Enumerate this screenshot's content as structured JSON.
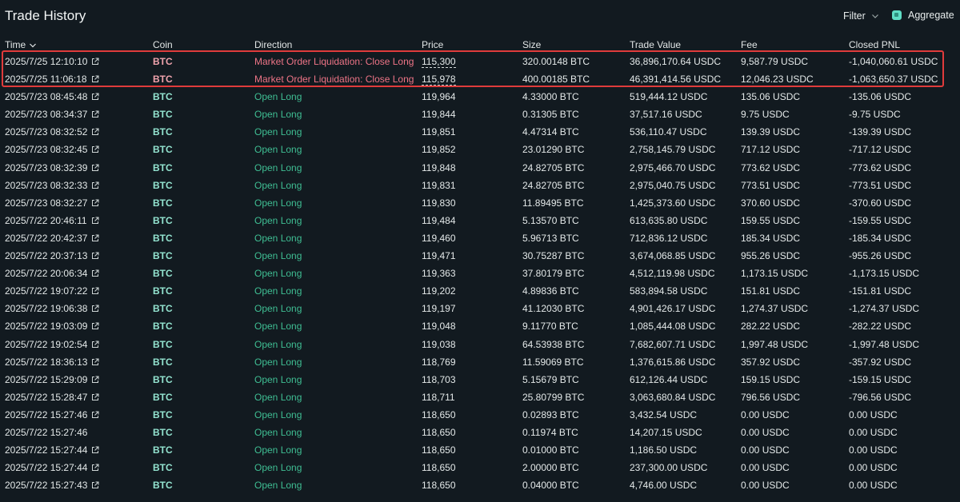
{
  "header": {
    "title": "Trade History",
    "filter_label": "Filter",
    "aggregate_label": "Aggregate",
    "aggregate_checked": true
  },
  "columns": [
    "Time",
    "Coin",
    "Direction",
    "Price",
    "Size",
    "Trade Value",
    "Fee",
    "Closed PNL"
  ],
  "colors": {
    "liquidation": "#ed7486",
    "open_long": "#3fbe93",
    "highlight_border": "#e03b3b",
    "checkbox": "#5fdcc4"
  },
  "rows": [
    {
      "time": "2025/7/25 12:10:10",
      "coin": "BTC",
      "direction": "Market Order Liquidation: Close Long",
      "price": "115,300",
      "size": "320.00148 BTC",
      "value": "36,896,170.64 USDC",
      "fee": "9,587.79 USDC",
      "pnl": "-1,040,060.61 USDC",
      "type": "liq"
    },
    {
      "time": "2025/7/25 11:06:18",
      "coin": "BTC",
      "direction": "Market Order Liquidation: Close Long",
      "price": "115,978",
      "size": "400.00185 BTC",
      "value": "46,391,414.56 USDC",
      "fee": "12,046.23 USDC",
      "pnl": "-1,063,650.37 USDC",
      "type": "liq"
    },
    {
      "time": "2025/7/23 08:45:48",
      "coin": "BTC",
      "direction": "Open Long",
      "price": "119,964",
      "size": "4.33000 BTC",
      "value": "519,444.12 USDC",
      "fee": "135.06 USDC",
      "pnl": "-135.06 USDC",
      "type": "long"
    },
    {
      "time": "2025/7/23 08:34:37",
      "coin": "BTC",
      "direction": "Open Long",
      "price": "119,844",
      "size": "0.31305 BTC",
      "value": "37,517.16 USDC",
      "fee": "9.75 USDC",
      "pnl": "-9.75 USDC",
      "type": "long"
    },
    {
      "time": "2025/7/23 08:32:52",
      "coin": "BTC",
      "direction": "Open Long",
      "price": "119,851",
      "size": "4.47314 BTC",
      "value": "536,110.47 USDC",
      "fee": "139.39 USDC",
      "pnl": "-139.39 USDC",
      "type": "long"
    },
    {
      "time": "2025/7/23 08:32:45",
      "coin": "BTC",
      "direction": "Open Long",
      "price": "119,852",
      "size": "23.01290 BTC",
      "value": "2,758,145.79 USDC",
      "fee": "717.12 USDC",
      "pnl": "-717.12 USDC",
      "type": "long"
    },
    {
      "time": "2025/7/23 08:32:39",
      "coin": "BTC",
      "direction": "Open Long",
      "price": "119,848",
      "size": "24.82705 BTC",
      "value": "2,975,466.70 USDC",
      "fee": "773.62 USDC",
      "pnl": "-773.62 USDC",
      "type": "long"
    },
    {
      "time": "2025/7/23 08:32:33",
      "coin": "BTC",
      "direction": "Open Long",
      "price": "119,831",
      "size": "24.82705 BTC",
      "value": "2,975,040.75 USDC",
      "fee": "773.51 USDC",
      "pnl": "-773.51 USDC",
      "type": "long"
    },
    {
      "time": "2025/7/23 08:32:27",
      "coin": "BTC",
      "direction": "Open Long",
      "price": "119,830",
      "size": "11.89495 BTC",
      "value": "1,425,373.60 USDC",
      "fee": "370.60 USDC",
      "pnl": "-370.60 USDC",
      "type": "long"
    },
    {
      "time": "2025/7/22 20:46:11",
      "coin": "BTC",
      "direction": "Open Long",
      "price": "119,484",
      "size": "5.13570 BTC",
      "value": "613,635.80 USDC",
      "fee": "159.55 USDC",
      "pnl": "-159.55 USDC",
      "type": "long"
    },
    {
      "time": "2025/7/22 20:42:37",
      "coin": "BTC",
      "direction": "Open Long",
      "price": "119,460",
      "size": "5.96713 BTC",
      "value": "712,836.12 USDC",
      "fee": "185.34 USDC",
      "pnl": "-185.34 USDC",
      "type": "long"
    },
    {
      "time": "2025/7/22 20:37:13",
      "coin": "BTC",
      "direction": "Open Long",
      "price": "119,471",
      "size": "30.75287 BTC",
      "value": "3,674,068.85 USDC",
      "fee": "955.26 USDC",
      "pnl": "-955.26 USDC",
      "type": "long"
    },
    {
      "time": "2025/7/22 20:06:34",
      "coin": "BTC",
      "direction": "Open Long",
      "price": "119,363",
      "size": "37.80179 BTC",
      "value": "4,512,119.98 USDC",
      "fee": "1,173.15 USDC",
      "pnl": "-1,173.15 USDC",
      "type": "long"
    },
    {
      "time": "2025/7/22 19:07:22",
      "coin": "BTC",
      "direction": "Open Long",
      "price": "119,202",
      "size": "4.89836 BTC",
      "value": "583,894.58 USDC",
      "fee": "151.81 USDC",
      "pnl": "-151.81 USDC",
      "type": "long"
    },
    {
      "time": "2025/7/22 19:06:38",
      "coin": "BTC",
      "direction": "Open Long",
      "price": "119,197",
      "size": "41.12030 BTC",
      "value": "4,901,426.17 USDC",
      "fee": "1,274.37 USDC",
      "pnl": "-1,274.37 USDC",
      "type": "long"
    },
    {
      "time": "2025/7/22 19:03:09",
      "coin": "BTC",
      "direction": "Open Long",
      "price": "119,048",
      "size": "9.11770 BTC",
      "value": "1,085,444.08 USDC",
      "fee": "282.22 USDC",
      "pnl": "-282.22 USDC",
      "type": "long"
    },
    {
      "time": "2025/7/22 19:02:54",
      "coin": "BTC",
      "direction": "Open Long",
      "price": "119,038",
      "size": "64.53938 BTC",
      "value": "7,682,607.71 USDC",
      "fee": "1,997.48 USDC",
      "pnl": "-1,997.48 USDC",
      "type": "long"
    },
    {
      "time": "2025/7/22 18:36:13",
      "coin": "BTC",
      "direction": "Open Long",
      "price": "118,769",
      "size": "11.59069 BTC",
      "value": "1,376,615.86 USDC",
      "fee": "357.92 USDC",
      "pnl": "-357.92 USDC",
      "type": "long"
    },
    {
      "time": "2025/7/22 15:29:09",
      "coin": "BTC",
      "direction": "Open Long",
      "price": "118,703",
      "size": "5.15679 BTC",
      "value": "612,126.44 USDC",
      "fee": "159.15 USDC",
      "pnl": "-159.15 USDC",
      "type": "long"
    },
    {
      "time": "2025/7/22 15:28:47",
      "coin": "BTC",
      "direction": "Open Long",
      "price": "118,711",
      "size": "25.80799 BTC",
      "value": "3,063,680.84 USDC",
      "fee": "796.56 USDC",
      "pnl": "-796.56 USDC",
      "type": "long"
    },
    {
      "time": "2025/7/22 15:27:46",
      "coin": "BTC",
      "direction": "Open Long",
      "price": "118,650",
      "size": "0.02893 BTC",
      "value": "3,432.54 USDC",
      "fee": "0.00 USDC",
      "pnl": "0.00 USDC",
      "type": "long",
      "link": true
    },
    {
      "time": "2025/7/22 15:27:46",
      "coin": "BTC",
      "direction": "Open Long",
      "price": "118,650",
      "size": "0.11974 BTC",
      "value": "14,207.15 USDC",
      "fee": "0.00 USDC",
      "pnl": "0.00 USDC",
      "type": "long",
      "link": false
    },
    {
      "time": "2025/7/22 15:27:44",
      "coin": "BTC",
      "direction": "Open Long",
      "price": "118,650",
      "size": "0.01000 BTC",
      "value": "1,186.50 USDC",
      "fee": "0.00 USDC",
      "pnl": "0.00 USDC",
      "type": "long"
    },
    {
      "time": "2025/7/22 15:27:44",
      "coin": "BTC",
      "direction": "Open Long",
      "price": "118,650",
      "size": "2.00000 BTC",
      "value": "237,300.00 USDC",
      "fee": "0.00 USDC",
      "pnl": "0.00 USDC",
      "type": "long"
    },
    {
      "time": "2025/7/22 15:27:43",
      "coin": "BTC",
      "direction": "Open Long",
      "price": "118,650",
      "size": "0.04000 BTC",
      "value": "4,746.00 USDC",
      "fee": "0.00 USDC",
      "pnl": "0.00 USDC",
      "type": "long"
    }
  ]
}
